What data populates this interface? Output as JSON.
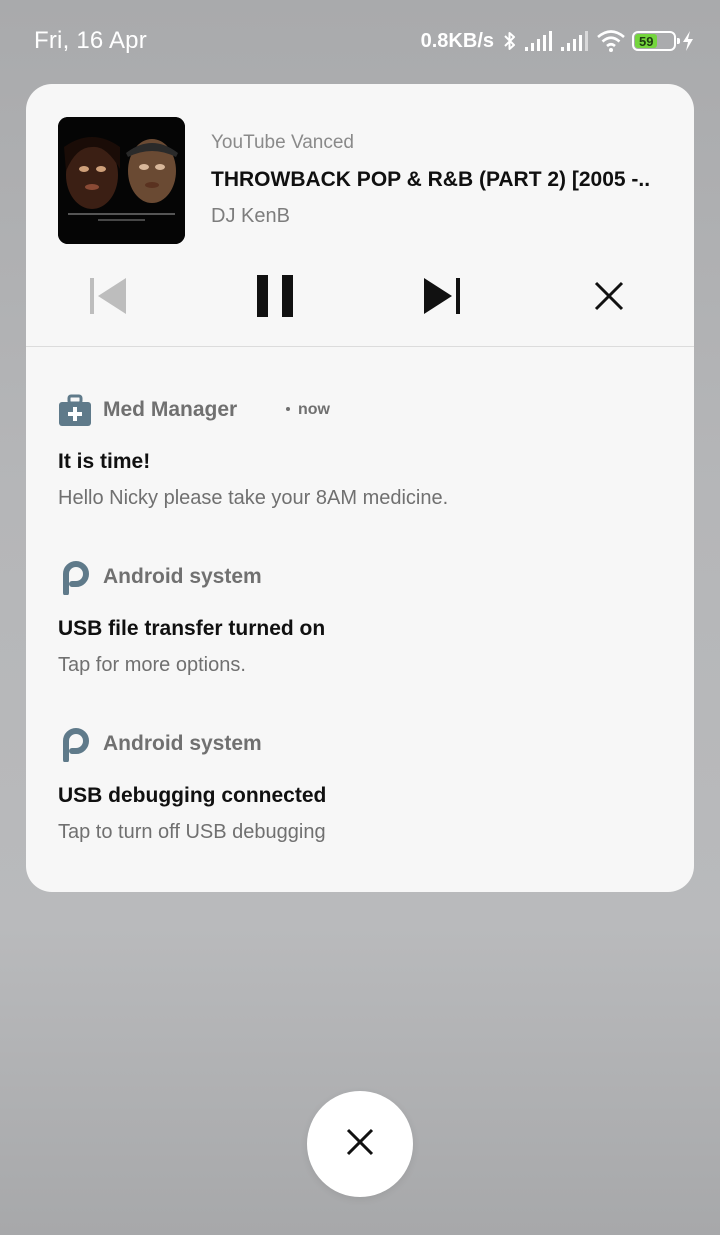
{
  "status_bar": {
    "date": "Fri, 16 Apr",
    "net_speed": "0.8KB/s",
    "battery_level": "59",
    "battery_fraction": 0.59,
    "icons": [
      "bluetooth-icon",
      "signal-icon",
      "signal-icon",
      "wifi-icon",
      "battery-icon",
      "charging-icon"
    ]
  },
  "media": {
    "app_name": "YouTube Vanced",
    "title": "THROWBACK POP & R&B (PART 2) [2005 -..",
    "artist": "DJ KenB",
    "controls": [
      "previous-icon",
      "pause-icon",
      "next-icon",
      "close-icon"
    ]
  },
  "notifications": [
    {
      "app": "Med Manager",
      "time": "now",
      "icon": "medical-kit-icon",
      "title": "It is time!",
      "body": "Hello Nicky please take your 8AM medicine."
    },
    {
      "app": "Android system",
      "icon": "android-system-p-icon",
      "title": "USB file transfer turned on",
      "body": "Tap for more options."
    },
    {
      "app": "Android system",
      "icon": "android-system-p-icon",
      "title": "USB debugging connected",
      "body": "Tap to turn off USB debugging"
    }
  ],
  "dismiss_all": {
    "icon": "close-icon"
  },
  "colors": {
    "accent_icon": "#5f7a8a",
    "battery_fill": "#74d53d",
    "panel_bg": "#f7f7f7",
    "title_text": "#101010",
    "secondary_text": "#707070"
  }
}
